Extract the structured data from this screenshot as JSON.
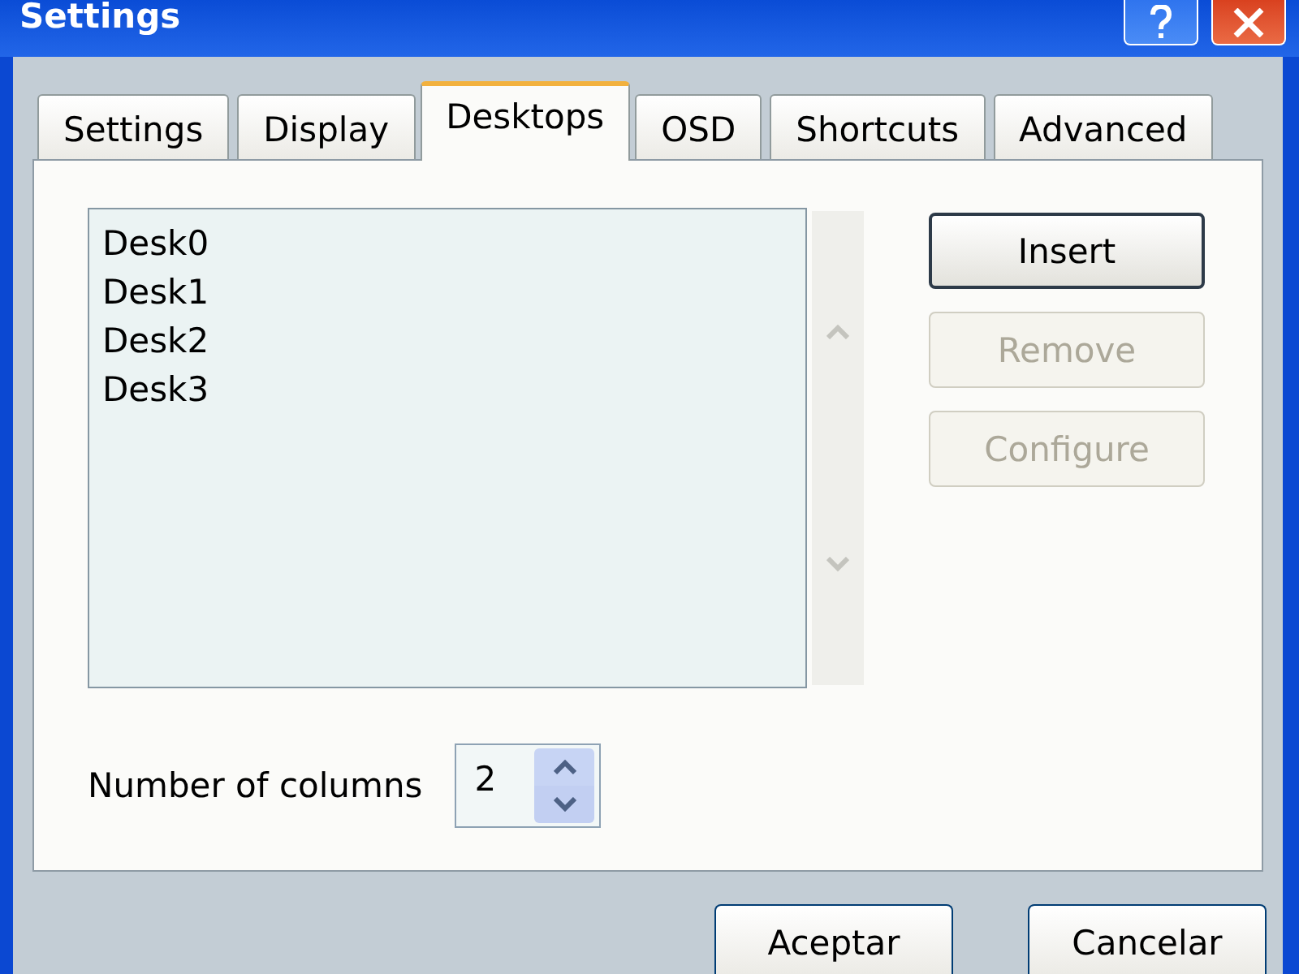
{
  "window": {
    "title": "Settings"
  },
  "tabs": [
    {
      "label": "Settings",
      "selected": false
    },
    {
      "label": "Display",
      "selected": false
    },
    {
      "label": "Desktops",
      "selected": true
    },
    {
      "label": "OSD",
      "selected": false
    },
    {
      "label": "Shortcuts",
      "selected": false
    },
    {
      "label": "Advanced",
      "selected": false
    }
  ],
  "desktops": {
    "items": [
      {
        "label": "Desk0",
        "selected": false
      },
      {
        "label": "Desk1",
        "selected": false
      },
      {
        "label": "Desk2",
        "selected": false
      },
      {
        "label": "Desk3",
        "selected": false
      }
    ]
  },
  "actions": [
    {
      "label": "Insert",
      "disabled": false,
      "default": true
    },
    {
      "label": "Remove",
      "disabled": true,
      "default": false
    },
    {
      "label": "Configure",
      "disabled": true,
      "default": false
    }
  ],
  "columns": {
    "label": "Number of columns",
    "value": "2"
  },
  "dialog_buttons": [
    {
      "label": "Aceptar"
    },
    {
      "label": "Cancelar"
    }
  ]
}
